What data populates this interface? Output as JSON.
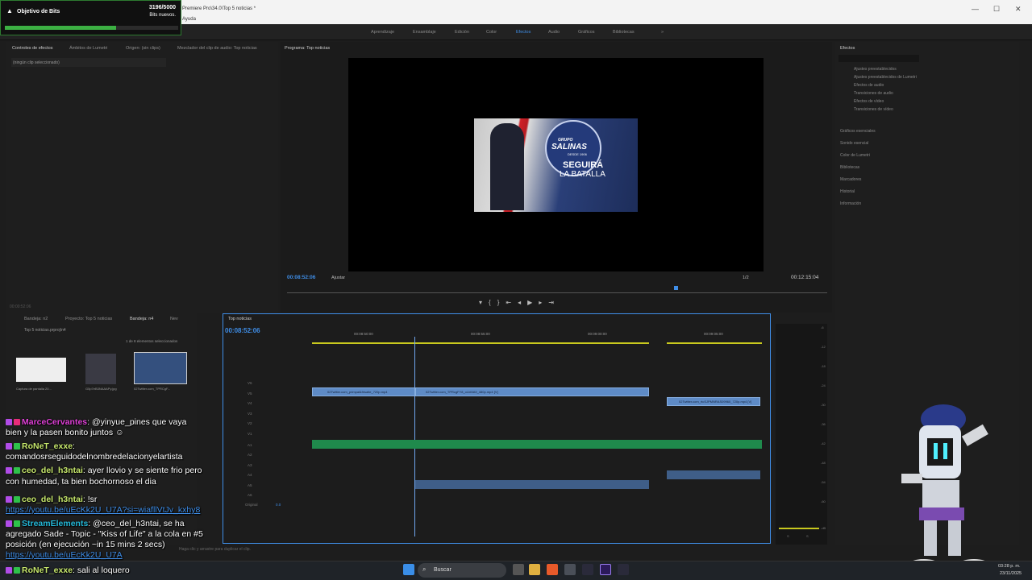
{
  "titlebar": {
    "title": "Premiere Pro\\34.0\\Top 5 noticias *",
    "menu": "Ayuda",
    "min": "—",
    "max": "☐",
    "close": "✕"
  },
  "workspaces": [
    {
      "label": "Aprendizaje"
    },
    {
      "label": "Ensamblaje"
    },
    {
      "label": "Edición"
    },
    {
      "label": "Color"
    },
    {
      "label": "Efectos",
      "active": true
    },
    {
      "label": "Audio"
    },
    {
      "label": "Gráficos"
    },
    {
      "label": "Bibliotecas"
    },
    {
      "label": "»"
    }
  ],
  "bits": {
    "title": "Objetivo de Bits",
    "value": "3196/5000",
    "subtitle": "Bits nuevos.",
    "progress": 0.64
  },
  "source_panel": {
    "tabs": [
      "Controles de efectos",
      "Ámbitos de Lumetri",
      "Origen: (sin clips)",
      "Mezclador del clip de audio: Top noticias"
    ],
    "empty": "(ningún clip seleccionado)",
    "timecode": "00:00:52:06"
  },
  "program": {
    "tab": "Programa: Top noticias",
    "timecode": "00:08:52:06",
    "fit": "Ajustar",
    "scale": "1/2",
    "duration": "00:12:15:04",
    "frame_text": {
      "brand_top": "GRUPO",
      "brand": "SALINAS",
      "since": "DESDE 1906",
      "line1": "SEGUIRÁ",
      "line2": "LA BATALLA"
    }
  },
  "project": {
    "tabs": [
      "Bandeja: n2",
      "Proyecto: Top 5 noticias",
      "Bandeja: n4",
      "Nev"
    ],
    "path": "Top 5 noticias.prproj\\n4",
    "selection": "1 de 8 elementos seleccionados",
    "thumbs": [
      {
        "name": "Captura de pantalla 20...",
        "dur": "5:00"
      },
      {
        "name": "G5p7eB3NAAAPy.jpg",
        "dur": "5:00"
      },
      {
        "name": "02Twitter.com_TPRCgF...",
        "dur": "1:22"
      }
    ]
  },
  "timeline": {
    "tab": "Top noticias",
    "timecode": "00:08:52:06",
    "ruler": [
      "00:08:50:00",
      "00:08:55:00",
      "00:09:00:00",
      "00:09:05:00"
    ],
    "video_tracks": [
      "V6",
      "V5",
      "V4",
      "V3",
      "V2",
      "V1"
    ],
    "audio_tracks": [
      "A1",
      "A2",
      "A3",
      "A4",
      "A5",
      "A6"
    ],
    "original": "Original",
    "original_val": "0.0",
    "clips": [
      "02Twitter.com_primpal&frisalte_720p.mp4",
      "02Twitter.com_TPRcgFY8_oLbMA9_480p.mp4 [V]",
      "02Twitter.com_rtcSJPMNRAS09960_720p.mp4 [V]"
    ]
  },
  "effects": {
    "title": "Efectos",
    "items": [
      "Ajustes preestablecidos",
      "Ajustes preestablecidos de Lumetri",
      "Efectos de audio",
      "Transiciones de audio",
      "Efectos de vídeo",
      "Transiciones de vídeo"
    ],
    "sections": [
      "Gráficos esenciales",
      "Sonido esencial",
      "Color de Lumetri",
      "Bibliotecas",
      "Marcadores",
      "Historial",
      "Información"
    ]
  },
  "meter": {
    "ticks": [
      "-6",
      "-12",
      "-18",
      "-24",
      "-30",
      "-36",
      "-42",
      "-48",
      "-54",
      "-60",
      "-dB"
    ],
    "foot": [
      "S",
      "S"
    ]
  },
  "status": "Haga clic y arrastre para duplicar el clip.",
  "chat": [
    {
      "user": "MarceCervantes",
      "text": ": @yinyue_pines que vaya",
      "cont": "bien y la pasen bonito juntos ☺"
    },
    {
      "user": "RoNeT_exxe",
      "text": ":",
      "cont": "comandosrseguidodelnombredelacionyelartista"
    },
    {
      "user": "ceo_del_h3ntai",
      "text": ": ayer llovio y se siente frio pero",
      "cont": "con humedad, ta bien bochornoso el dia"
    },
    {
      "user": "ceo_del_h3ntai",
      "text": ": !sr",
      "link": "https://youtu.be/uEcKk2U_U7A?si=wiafllVtJv_kxhy8"
    },
    {
      "user": "StreamElements",
      "text": ": @ceo_del_h3ntai, se ha",
      "cont": "agregado Sade - Topic - \"Kiss of Life\" a la cola en #5",
      "cont2": "posición (en ejecución ~in 15 mins 2 secs)",
      "link": "https://youtu.be/uEcKk2U_U7A"
    },
    {
      "user": "RoNeT_exxe",
      "text": ": sali al loquero"
    }
  ],
  "taskbar": {
    "search": "Buscar",
    "time": "03:28 p. m.",
    "date": "23/11/2025"
  },
  "colors": {
    "accent": "#3f8ee8",
    "bits_green": "#3cb043",
    "chat_lime": "#c7e86c"
  }
}
